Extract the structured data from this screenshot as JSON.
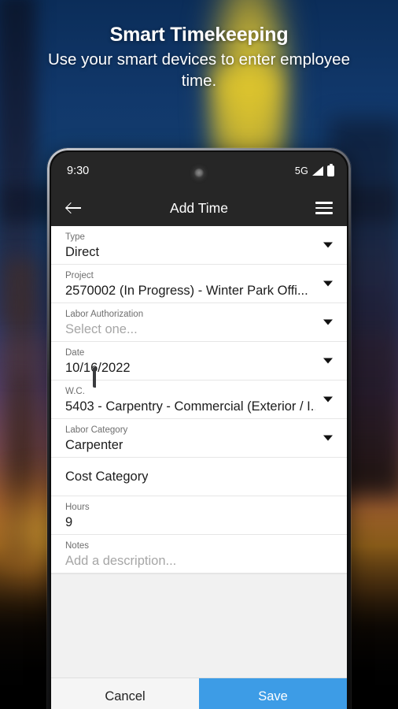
{
  "promo": {
    "headline": "Smart Timekeeping",
    "subheadline": "Use your smart devices to enter employee time."
  },
  "colors": {
    "save_button": "#3d9ce6",
    "app_bar": "#262626",
    "field_background": "#ffffff",
    "screen_background": "#f1f1f1",
    "placeholder_text": "#a6a6a6",
    "label_text": "#6e6e6e"
  },
  "phone": {
    "status_bar": {
      "time": "9:30",
      "network": "5G",
      "signal_icon": "signal-triangle-icon",
      "battery_icon": "battery-full-icon",
      "camera_icon": "front-camera-icon"
    },
    "app_bar": {
      "back_icon": "back-arrow-icon",
      "title": "Add Time",
      "menu_icon": "hamburger-menu-icon"
    },
    "form": {
      "fields": [
        {
          "label": "Type",
          "value": "Direct",
          "placeholder": false,
          "caret": true,
          "name": "type"
        },
        {
          "label": "Project",
          "value": "2570002 (In Progress) - Winter Park Offi...",
          "placeholder": false,
          "caret": true,
          "name": "project"
        },
        {
          "label": "Labor Authorization",
          "value": "Select one...",
          "placeholder": true,
          "caret": true,
          "name": "labor-authorization"
        },
        {
          "label": "Date",
          "value": "10/16/2022",
          "placeholder": false,
          "caret": true,
          "name": "date"
        },
        {
          "label": "W.C.",
          "value": "5403 - Carpentry - Commercial (Exterior / I...",
          "placeholder": false,
          "caret": true,
          "name": "wc"
        },
        {
          "label": "Labor Category",
          "value": "Carpenter",
          "placeholder": false,
          "caret": true,
          "name": "labor-category"
        },
        {
          "label": "",
          "value": "Cost Category",
          "placeholder": false,
          "caret": false,
          "name": "cost-category"
        },
        {
          "label": "Hours",
          "value": "9",
          "placeholder": false,
          "caret": false,
          "name": "hours"
        },
        {
          "label": "Notes",
          "value": "Add a description...",
          "placeholder": true,
          "caret": false,
          "name": "notes"
        }
      ]
    },
    "actions": {
      "cancel_label": "Cancel",
      "save_label": "Save"
    }
  }
}
